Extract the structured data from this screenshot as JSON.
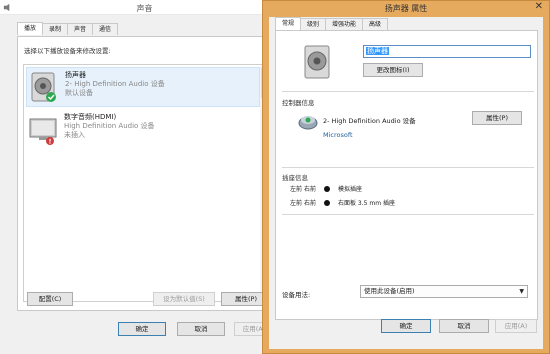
{
  "sound_window": {
    "title": "声音",
    "tabs": [
      "播放",
      "录制",
      "声音",
      "通信"
    ],
    "instruction": "选择以下播放设备来修改设置:",
    "devices": [
      {
        "name": "扬声器",
        "desc": "2- High Definition Audio 设备",
        "status": "默认设备"
      },
      {
        "name": "数字音频(HDMI)",
        "desc": "High Definition Audio 设备",
        "status": "未插入"
      }
    ],
    "buttons": {
      "configure": "配置(C)",
      "set_default": "设为默认值(S)",
      "properties": "属性(P)",
      "ok": "确定",
      "cancel": "取消",
      "apply": "应用(A)"
    }
  },
  "properties_window": {
    "title": "扬声器 属性",
    "tabs": [
      "常规",
      "级别",
      "增强功能",
      "高级"
    ],
    "name_value": "扬声器",
    "change_icon": "更改图标(I)",
    "controller_section": "控制器信息",
    "controller_name": "2- High Definition Audio 设备",
    "controller_vendor": "Microsoft",
    "controller_properties": "属性(P)",
    "jack_section": "插座信息",
    "jacks": [
      {
        "col1": "左前",
        "col2": "右前",
        "label": "模拟插座"
      },
      {
        "col1": "左前",
        "col2": "右前",
        "label": "右面板 3.5 mm 插座"
      }
    ],
    "usage_label": "设备用法:",
    "usage_value": "使用此设备(启用)",
    "buttons": {
      "ok": "确定",
      "cancel": "取消",
      "apply": "应用(A)"
    },
    "close_glyph": "✕"
  }
}
